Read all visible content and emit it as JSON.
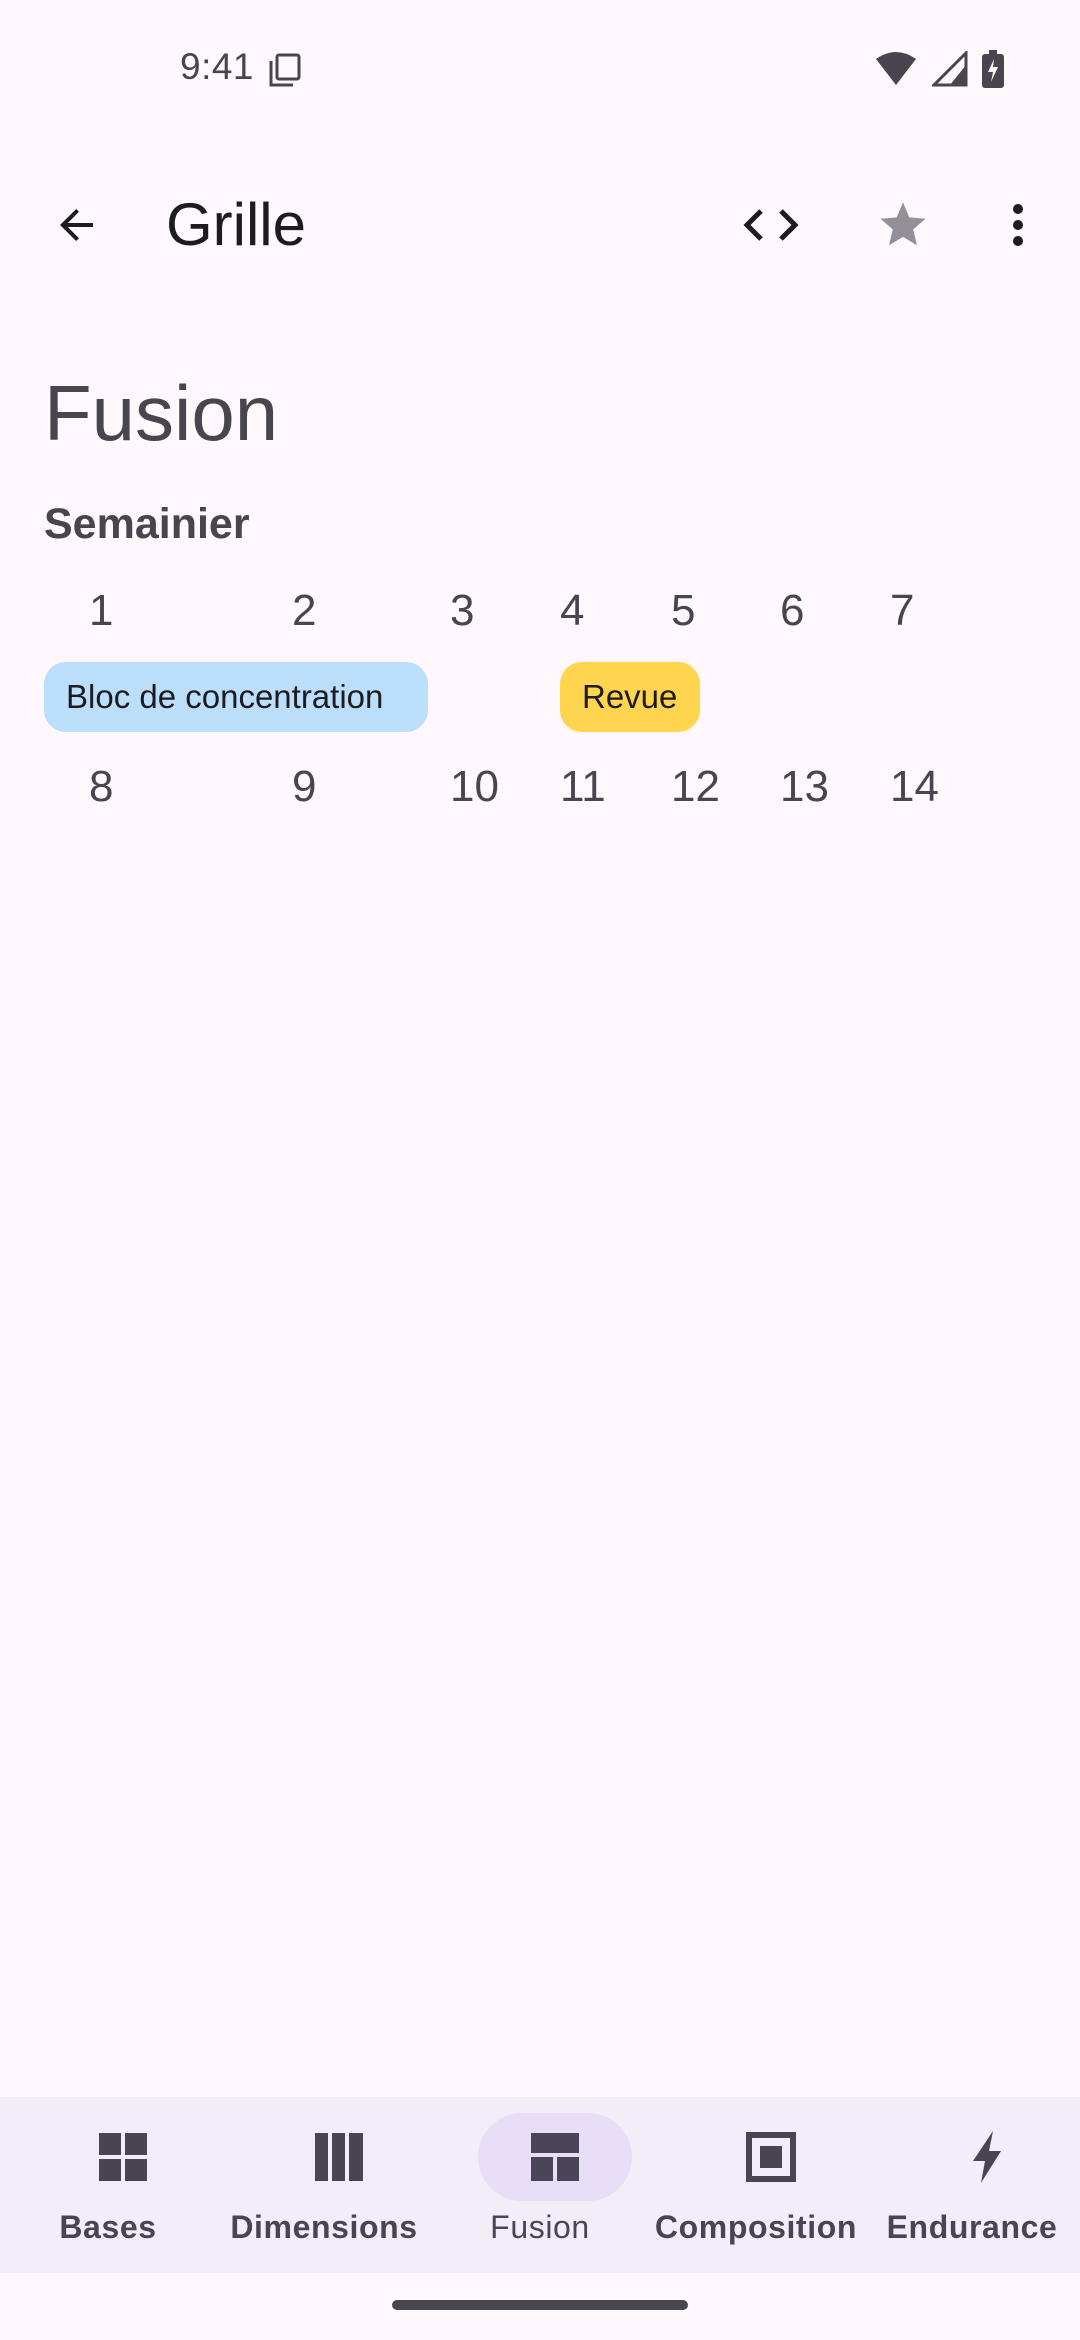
{
  "status_bar": {
    "time": "9:41",
    "icons": [
      "copy-notification-icon",
      "wifi-icon",
      "signal-icon",
      "battery-charging-icon"
    ]
  },
  "app_bar": {
    "title": "Grille",
    "back_icon": "arrow-back-icon",
    "actions": [
      "code-icon",
      "star-icon",
      "more-vert-icon"
    ]
  },
  "main": {
    "heading": "Fusion",
    "section_label": "Semainier",
    "week1": [
      "1",
      "2",
      "3",
      "4",
      "5",
      "6",
      "7"
    ],
    "week2": [
      "8",
      "9",
      "10",
      "11",
      "12",
      "13",
      "14"
    ],
    "events": [
      {
        "label": "Bloc de concentration",
        "color": "#BBDEFB"
      },
      {
        "label": "Revue",
        "color": "#FFD54F"
      }
    ]
  },
  "bottom_nav": {
    "items": [
      {
        "label": "Bases",
        "icon": "grid-icon",
        "active": false
      },
      {
        "label": "Dimensions",
        "icon": "columns-icon",
        "active": false
      },
      {
        "label": "Fusion",
        "icon": "merged-layout-icon",
        "active": true
      },
      {
        "label": "Composition",
        "icon": "nested-square-icon",
        "active": false
      },
      {
        "label": "Endurance",
        "icon": "bolt-icon",
        "active": false
      }
    ]
  },
  "colors": {
    "background": "#FEF7FC",
    "nav_background": "#F3EDF7",
    "nav_active_pill": "#E8DEF8",
    "text": "#49454F"
  }
}
